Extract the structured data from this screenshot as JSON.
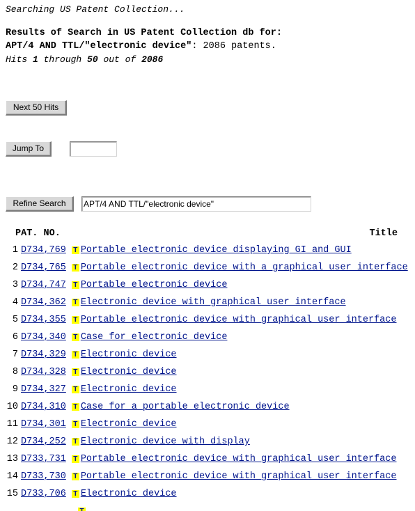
{
  "status": {
    "searching_text": "Searching US Patent Collection..."
  },
  "results_header": {
    "line1": "Results of Search in US Patent Collection db for:",
    "query": "APT/4 AND TTL/\"electronic device\"",
    "count_suffix": ": 2086 patents.",
    "hits_prefix": "Hits ",
    "hits_from": "1",
    "hits_mid": " through ",
    "hits_to": "50",
    "hits_outof": " out of ",
    "hits_total": "2086"
  },
  "controls": {
    "next_hits_label": "Next 50 Hits",
    "jump_to_label": "Jump To",
    "jump_to_value": "",
    "jump_to_placeholder": "",
    "refine_search_label": "Refine Search",
    "refine_search_value": "APT/4 AND TTL/\"electronic device\"",
    "refine_search_placeholder": ""
  },
  "table": {
    "col_patno": "PAT. NO.",
    "col_title": "Title",
    "icon_glyph": "T",
    "icon_bg_color": "#FFFF00",
    "icon_fg_color": "#00148C",
    "link_color": "#00148C",
    "rows": [
      {
        "index": "1",
        "patno": "D734,769",
        "title": "Portable electronic device displaying GI and GUI"
      },
      {
        "index": "2",
        "patno": "D734,765",
        "title": "Portable electronic device with a graphical user interface"
      },
      {
        "index": "3",
        "patno": "D734,747",
        "title": "Portable electronic device"
      },
      {
        "index": "4",
        "patno": "D734,362",
        "title": "Electronic device with graphical user interface"
      },
      {
        "index": "5",
        "patno": "D734,355",
        "title": "Portable electronic device with graphical user interface"
      },
      {
        "index": "6",
        "patno": "D734,340",
        "title": "Case for electronic device"
      },
      {
        "index": "7",
        "patno": "D734,329",
        "title": "Electronic device"
      },
      {
        "index": "8",
        "patno": "D734,328",
        "title": "Electronic device"
      },
      {
        "index": "9",
        "patno": "D734,327",
        "title": "Electronic device"
      },
      {
        "index": "10",
        "patno": "D734,310",
        "title": "Case for a portable electronic device"
      },
      {
        "index": "11",
        "patno": "D734,301",
        "title": "Electronic device"
      },
      {
        "index": "12",
        "patno": "D734,252",
        "title": "Electronic device with display"
      },
      {
        "index": "13",
        "patno": "D733,731",
        "title": "Portable electronic device with graphical user interface"
      },
      {
        "index": "14",
        "patno": "D733,730",
        "title": "Portable electronic device with graphical user interface"
      },
      {
        "index": "15",
        "patno": "D733,706",
        "title": "Electronic device"
      }
    ]
  }
}
